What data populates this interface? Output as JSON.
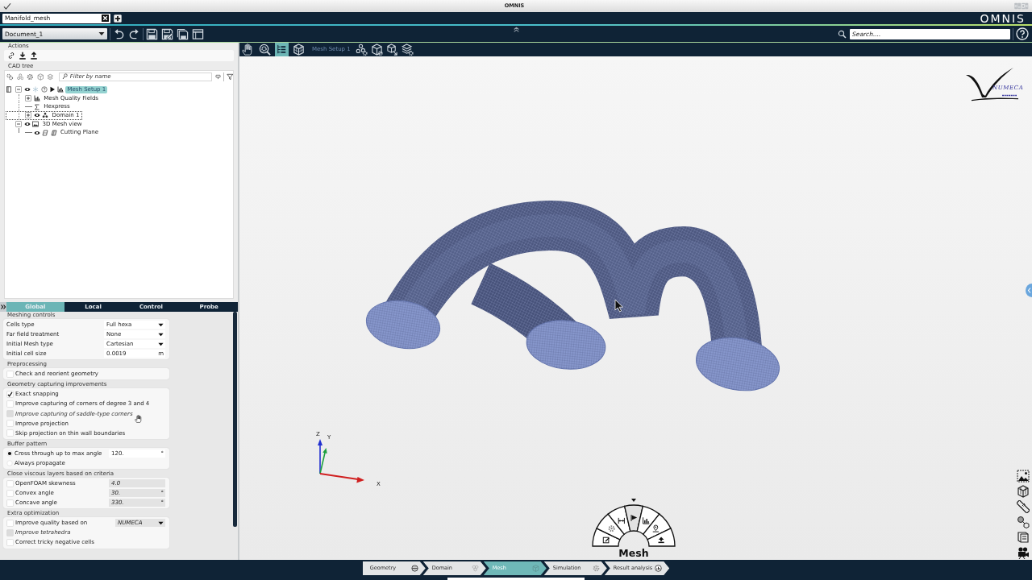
{
  "window": {
    "title": "OMNIS",
    "app_logo": "OMNIS"
  },
  "document_tabs": [
    {
      "label": "Manifold_mesh",
      "selected": true
    }
  ],
  "toolbar": {
    "document": "Document_1",
    "search": {
      "placeholder": "Search...."
    }
  },
  "actions": {
    "title": "Actions"
  },
  "cad_tree": {
    "title": "CAD tree",
    "filter": {
      "placeholder": "Filter by name"
    },
    "items": [
      {
        "kind": "setup",
        "label": "Mesh Setup 1",
        "selected": true,
        "focused": false,
        "expanded": true,
        "children": [
          {
            "kind": "fields",
            "label": "Mesh Quality Fields",
            "selected": false,
            "focused": false,
            "expanded": false
          },
          {
            "kind": "formula",
            "label": "Hexpress",
            "selected": false,
            "focused": false
          },
          {
            "kind": "domain",
            "label": "Domain 1",
            "selected": false,
            "focused": true,
            "expanded": false
          }
        ]
      },
      {
        "kind": "view",
        "label": "3D Mesh view",
        "selected": false,
        "focused": false,
        "expanded": true,
        "children": [
          {
            "kind": "plane",
            "label": "Cutting Plane",
            "selected": false,
            "focused": false
          }
        ]
      }
    ]
  },
  "settings": {
    "tabs": [
      {
        "label": "Global",
        "selected": true
      },
      {
        "label": "Local",
        "selected": false
      },
      {
        "label": "Control",
        "selected": false
      },
      {
        "label": "Probe",
        "selected": false
      }
    ],
    "sections": [
      {
        "title": "Meshing controls",
        "rows": [
          {
            "kind": "plain",
            "label": "Cells type",
            "field": {
              "kind": "select",
              "value": "Full hexa",
              "disabled": false
            }
          },
          {
            "kind": "plain",
            "label": "Far field treatment",
            "field": {
              "kind": "select",
              "value": "None",
              "disabled": false
            }
          },
          {
            "kind": "plain",
            "label": "Initial Mesh type",
            "field": {
              "kind": "select",
              "value": "Cartesian",
              "disabled": false
            }
          },
          {
            "kind": "plain",
            "label": "Initial cell size",
            "field": {
              "kind": "number",
              "value": "0.0019",
              "unit": "m",
              "disabled": false
            }
          }
        ]
      },
      {
        "title": "Preprocessing",
        "rows": [
          {
            "kind": "checkbox",
            "label": "Check and reorient geometry",
            "checked": false,
            "disabled": false
          }
        ]
      },
      {
        "title": "Geometry capturing improvements",
        "rows": [
          {
            "kind": "checkbox",
            "label": "Exact snapping",
            "checked": true,
            "disabled": false
          },
          {
            "kind": "checkbox",
            "label": "Improve capturing of corners of degree 3 and 4",
            "checked": false,
            "disabled": false
          },
          {
            "kind": "checkbox",
            "label": "Improve capturing of saddle-type corners",
            "checked": false,
            "disabled": true
          },
          {
            "kind": "checkbox",
            "label": "Improve projection",
            "checked": false,
            "disabled": false
          },
          {
            "kind": "checkbox",
            "label": "Skip projection on thin wall boundaries",
            "checked": false,
            "disabled": false
          }
        ]
      },
      {
        "title": "Buffer pattern",
        "rows": [
          {
            "kind": "radio",
            "label": "Cross through up to max angle",
            "selected": true,
            "field": {
              "kind": "number",
              "value": "120.",
              "unit": "°",
              "disabled": false
            }
          },
          {
            "kind": "radio",
            "label": "Always propagate",
            "selected": false
          }
        ]
      },
      {
        "title": "Close viscous layers based on criteria",
        "rows": [
          {
            "kind": "checkbox",
            "label": "OpenFOAM skewness",
            "checked": false,
            "disabled": false,
            "field": {
              "kind": "number",
              "value": "4.0",
              "disabled": true
            }
          },
          {
            "kind": "checkbox",
            "label": "Convex angle",
            "checked": false,
            "disabled": false,
            "field": {
              "kind": "number",
              "value": "30.",
              "unit": "°",
              "disabled": true
            }
          },
          {
            "kind": "checkbox",
            "label": "Concave angle",
            "checked": false,
            "disabled": false,
            "field": {
              "kind": "number",
              "value": "330.",
              "unit": "°",
              "disabled": true
            }
          }
        ]
      },
      {
        "title": "Extra optimization",
        "rows": [
          {
            "kind": "checkbox",
            "label": "Improve quality based on",
            "checked": false,
            "disabled": false,
            "field": {
              "kind": "select",
              "value": "NUMECA",
              "disabled": true
            }
          },
          {
            "kind": "checkbox",
            "label": "Improve tetrahedra",
            "checked": false,
            "disabled": true
          },
          {
            "kind": "checkbox",
            "label": "Correct tricky negative cells",
            "checked": false,
            "disabled": false
          }
        ]
      }
    ]
  },
  "viewport": {
    "tools": [
      {
        "kind": "pan",
        "selected": false
      },
      {
        "kind": "zoom",
        "selected": false
      },
      {
        "kind": "tree",
        "selected": true
      },
      {
        "kind": "mesh",
        "selected": false
      }
    ],
    "context_label": "Mesh Setup 1",
    "logo": {
      "text": "NUMECA"
    },
    "axes": {
      "x": "X",
      "y": "Y",
      "z": "Z"
    },
    "radial_menu": {
      "label": "Mesh",
      "items": [
        {
          "kind": "edit",
          "selected": false
        },
        {
          "kind": "settings",
          "selected": false
        },
        {
          "kind": "dimension",
          "selected": false
        },
        {
          "kind": "run",
          "selected": true
        },
        {
          "kind": "chart",
          "selected": false
        },
        {
          "kind": "probe",
          "selected": false
        },
        {
          "kind": "export",
          "selected": false
        }
      ]
    }
  },
  "workflow": [
    {
      "kind": "geometry",
      "label": "Geometry",
      "selected": false
    },
    {
      "kind": "domain",
      "label": "Domain",
      "selected": false
    },
    {
      "kind": "mesh",
      "label": "Mesh",
      "selected": true
    },
    {
      "kind": "simulation",
      "label": "Simulation",
      "selected": false
    },
    {
      "kind": "results",
      "label": "Result analysis",
      "selected": false
    }
  ]
}
